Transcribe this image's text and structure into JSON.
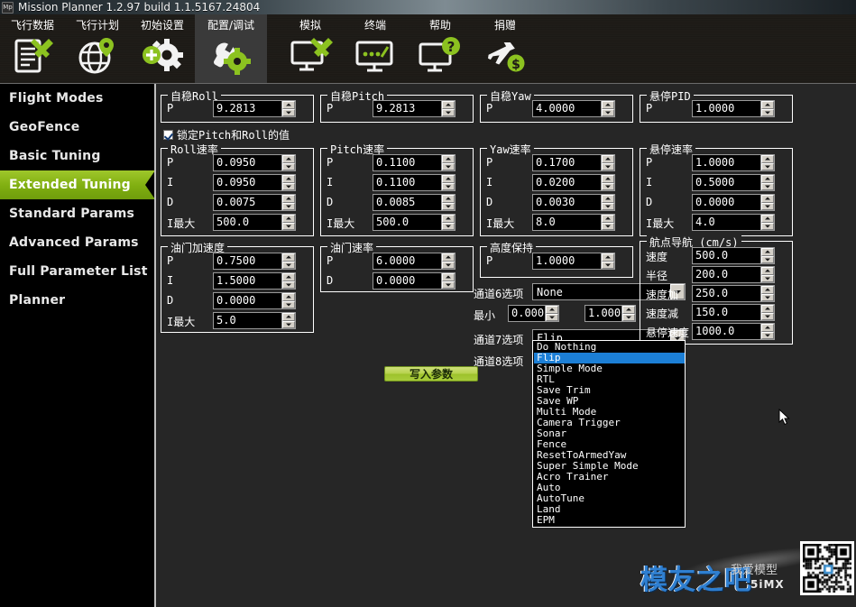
{
  "window": {
    "icon": "mp-app-icon",
    "icon_text": "Mp",
    "title": "Mission Planner 1.2.97 build 1.1.5167.24804"
  },
  "toolbar": {
    "items": [
      {
        "label": "飞行数据",
        "icon": "flight-data-icon",
        "active": false
      },
      {
        "label": "飞行计划",
        "icon": "flight-plan-globe-icon",
        "active": false
      },
      {
        "label": "初始设置",
        "icon": "initial-setup-gear-icon",
        "active": false
      },
      {
        "label": "配置/调试",
        "icon": "config-tuning-wrench-icon",
        "active": true
      },
      {
        "label": "模拟",
        "icon": "simulation-monitor-icon",
        "active": false
      },
      {
        "label": "终端",
        "icon": "terminal-monitor-icon",
        "active": false
      },
      {
        "label": "帮助",
        "icon": "help-monitor-icon",
        "active": false
      },
      {
        "label": "捐赠",
        "icon": "donate-plane-icon",
        "active": false
      }
    ]
  },
  "sidebar": {
    "items": [
      {
        "label": "Flight Modes",
        "selected": false
      },
      {
        "label": "GeoFence",
        "selected": false
      },
      {
        "label": "Basic Tuning",
        "selected": false
      },
      {
        "label": "Extended Tuning",
        "selected": true
      },
      {
        "label": "Standard Params",
        "selected": false
      },
      {
        "label": "Advanced Params",
        "selected": false
      },
      {
        "label": "Full Parameter List",
        "selected": false
      },
      {
        "label": "Planner",
        "selected": false
      }
    ],
    "accent_color": "#8fbb19"
  },
  "main": {
    "lock_checkbox": {
      "label": "锁定Pitch和Roll的值",
      "checked": true
    },
    "write_button": {
      "label": "写入参数"
    },
    "groups": [
      {
        "title": "自稳Roll",
        "rows": [
          {
            "label": "P",
            "value": "9.2813"
          }
        ]
      },
      {
        "title": "自稳Pitch",
        "rows": [
          {
            "label": "P",
            "value": "9.2813"
          }
        ]
      },
      {
        "title": "自稳Yaw",
        "rows": [
          {
            "label": "P",
            "value": "4.0000"
          }
        ]
      },
      {
        "title": "悬停PID",
        "rows": [
          {
            "label": "P",
            "value": "1.0000"
          }
        ]
      },
      {
        "title": "Roll速率",
        "rows": [
          {
            "label": "P",
            "value": "0.0950"
          },
          {
            "label": "I",
            "value": "0.0950"
          },
          {
            "label": "D",
            "value": "0.0075"
          },
          {
            "label": "I最大",
            "value": "500.0"
          }
        ]
      },
      {
        "title": "Pitch速率",
        "rows": [
          {
            "label": "P",
            "value": "0.1100"
          },
          {
            "label": "I",
            "value": "0.1100"
          },
          {
            "label": "D",
            "value": "0.0085"
          },
          {
            "label": "I最大",
            "value": "500.0"
          }
        ]
      },
      {
        "title": "Yaw速率",
        "rows": [
          {
            "label": "P",
            "value": "0.1700"
          },
          {
            "label": "I",
            "value": "0.0200"
          },
          {
            "label": "D",
            "value": "0.0030"
          },
          {
            "label": "I最大",
            "value": "8.0"
          }
        ]
      },
      {
        "title": "悬停速率",
        "rows": [
          {
            "label": "P",
            "value": "1.0000"
          },
          {
            "label": "I",
            "value": "0.5000"
          },
          {
            "label": "D",
            "value": "0.0000"
          },
          {
            "label": "I最大",
            "value": "4.0"
          }
        ]
      },
      {
        "title": "油门加速度",
        "rows": [
          {
            "label": "P",
            "value": "0.7500"
          },
          {
            "label": "I",
            "value": "1.5000"
          },
          {
            "label": "D",
            "value": "0.0000"
          },
          {
            "label": "I最大",
            "value": "5.0"
          }
        ]
      },
      {
        "title": "油门速率",
        "rows": [
          {
            "label": "P",
            "value": "6.0000"
          },
          {
            "label": "D",
            "value": "0.0000"
          }
        ]
      },
      {
        "title": "高度保持",
        "rows": [
          {
            "label": "P",
            "value": "1.0000"
          }
        ]
      },
      {
        "title": "航点导航 (cm/s)",
        "rows": [
          {
            "label": "速度",
            "value": "500.0"
          },
          {
            "label": "半径",
            "value": "200.0"
          },
          {
            "label": "速度加",
            "value": "250.0"
          },
          {
            "label": "速度减",
            "value": "150.0"
          },
          {
            "label": "悬停速度",
            "value": "1000.0"
          }
        ]
      }
    ],
    "channel_options": [
      {
        "label": "通道6选项",
        "value": "None"
      },
      {
        "label": "通道7选项",
        "value": "Flip"
      },
      {
        "label": "通道8选项",
        "value": ""
      }
    ],
    "ch6_range": {
      "label": "最小",
      "min": "0.000",
      "max": "1.000"
    },
    "dropdown": {
      "open": true,
      "selected": "Flip",
      "items": [
        "Do Nothing",
        "Flip",
        "Simple Mode",
        "RTL",
        "Save Trim",
        "Save WP",
        "Multi Mode",
        "Camera Trigger",
        "Sonar",
        "Fence",
        "ResetToArmedYaw",
        "Super Simple Mode",
        "Acro Trainer",
        "Auto",
        "AutoTune",
        "Land",
        "EPM"
      ],
      "highlight_color": "#1c7fd6"
    }
  },
  "watermark": {
    "logo_text": "模友之吧",
    "sub_text": "我爱模型",
    "sub_text2": "5iMX",
    "qr": "qr-code-icon"
  }
}
